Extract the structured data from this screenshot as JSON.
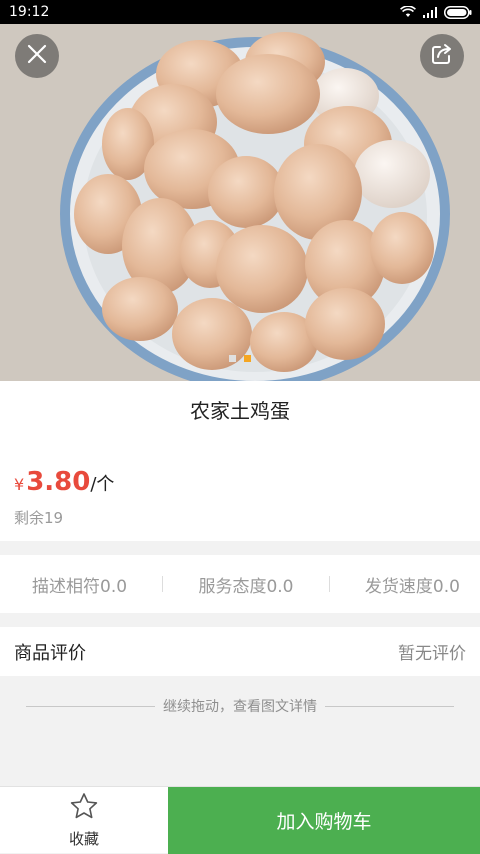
{
  "status_bar": {
    "time": "19:12",
    "icons": [
      "wifi-icon",
      "signal-icon",
      "battery-icon"
    ]
  },
  "gallery": {
    "image": "photo of a bowl of brown farm eggs",
    "page_count": 2,
    "active_index": 1,
    "buttons": [
      "close-icon",
      "share-icon"
    ]
  },
  "product": {
    "title": "农家土鸡蛋",
    "currency": "¥",
    "price": "3.80",
    "unit": "/个",
    "stock": "剩余19"
  },
  "ratings": [
    {
      "label": "描述相符0.0"
    },
    {
      "label": "服务态度0.0"
    },
    {
      "label": "发货速度0.0"
    }
  ],
  "reviews": {
    "title": "商品评价",
    "empty_text": "暂无评价"
  },
  "drag_hint": {
    "text": "继续拖动，查看图文详情"
  },
  "bottom_bar": {
    "favorite_label": "收藏",
    "favorite_icon": "star-outline-icon",
    "add_to_cart_label": "加入购物车"
  },
  "colors": {
    "price": "#e84a3c",
    "cart_button": "#4caf50",
    "active_dot": "#f5a623"
  }
}
